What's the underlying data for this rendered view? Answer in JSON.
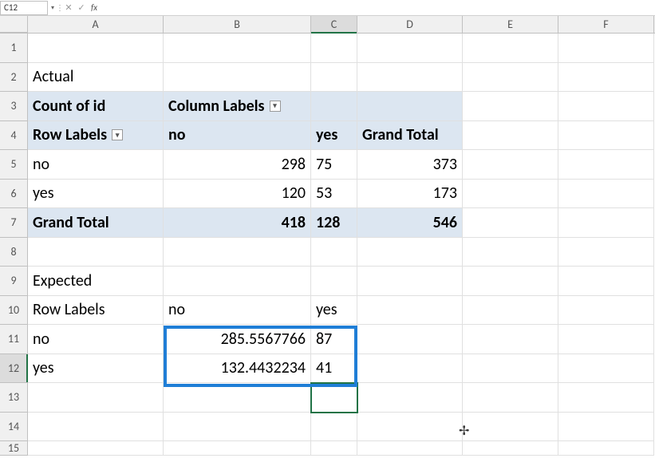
{
  "nameBox": "C12",
  "formula": "",
  "colHeaders": [
    "A",
    "B",
    "C",
    "D",
    "E",
    "F"
  ],
  "rowNumbers": [
    "1",
    "2",
    "3",
    "4",
    "5",
    "6",
    "7",
    "8",
    "9",
    "10",
    "11",
    "12",
    "13",
    "14",
    "15"
  ],
  "cells": {
    "A2": "Actual",
    "A3": "Count of id",
    "B3": "Column Labels",
    "A4": "Row Labels",
    "B4": "no",
    "C4": "yes",
    "D4": "Grand Total",
    "A5": "no",
    "B5": "298",
    "C5": "75",
    "D5": "373",
    "A6": "yes",
    "B6": "120",
    "C6": "53",
    "D6": "173",
    "A7": "Grand Total",
    "B7": "418",
    "C7": "128",
    "D7": "546",
    "A9": "Expected",
    "A10": "Row Labels",
    "B10": "no",
    "C10": "yes",
    "A11": "no",
    "B11": "285.5567766",
    "C11": "87",
    "A12": "yes",
    "B12": "132.4432234",
    "C12": "41"
  }
}
